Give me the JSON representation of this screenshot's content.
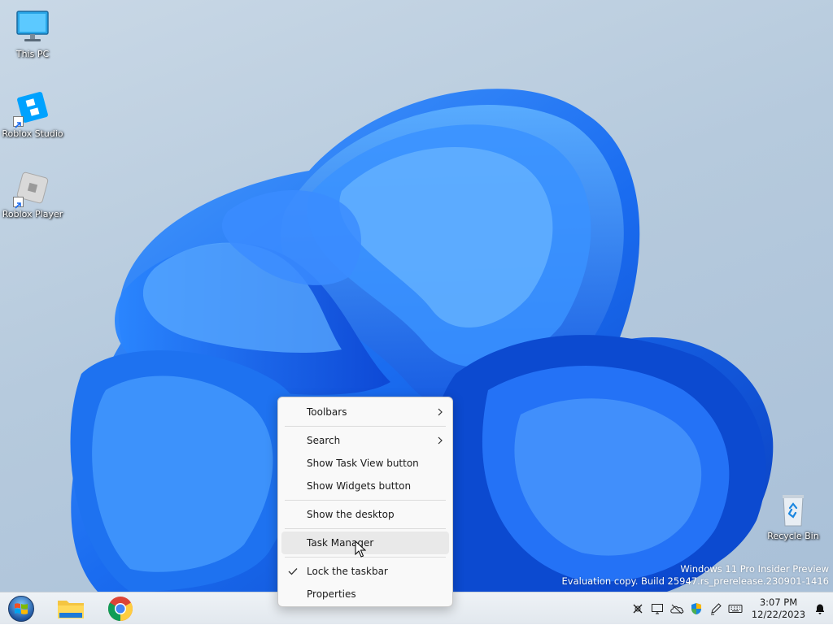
{
  "desktop_icons": [
    {
      "label": "This PC",
      "icon": "this-pc-icon"
    },
    {
      "label": "Roblox Studio",
      "icon": "roblox-studio-icon"
    },
    {
      "label": "Roblox Player",
      "icon": "roblox-player-icon"
    },
    {
      "label": "Recycle Bin",
      "icon": "recycle-bin-icon"
    }
  ],
  "context_menu": {
    "items": [
      {
        "label": "Toolbars",
        "submenu": true
      },
      {
        "label": "Search",
        "submenu": true
      },
      {
        "label": "Show Task View button"
      },
      {
        "label": "Show Widgets button"
      },
      {
        "label": "Show the desktop"
      },
      {
        "label": "Task Manager",
        "hovered": true
      },
      {
        "label": "Lock the taskbar",
        "checked": true
      },
      {
        "label": "Properties"
      }
    ]
  },
  "watermark": {
    "line1": "Windows 11 Pro Insider Preview",
    "line2": "Evaluation copy. Build 25947.rs_prerelease.230901-1416"
  },
  "taskbar": {
    "pinned": [
      {
        "name": "start-orb-icon"
      },
      {
        "name": "file-explorer-icon"
      },
      {
        "name": "chrome-icon"
      }
    ],
    "tray_icons": [
      "network-off-icon",
      "display-icon",
      "onedrive-icon",
      "defender-icon",
      "pen-icon",
      "keyboard-icon"
    ],
    "clock": {
      "time": "3:07 PM",
      "date": "12/22/2023"
    },
    "notification_icon": "bell-icon"
  },
  "colors": {
    "accent": "#1a6cf0",
    "menu_bg": "#f9f9f9",
    "taskbar_bg": "#e8edf2"
  }
}
